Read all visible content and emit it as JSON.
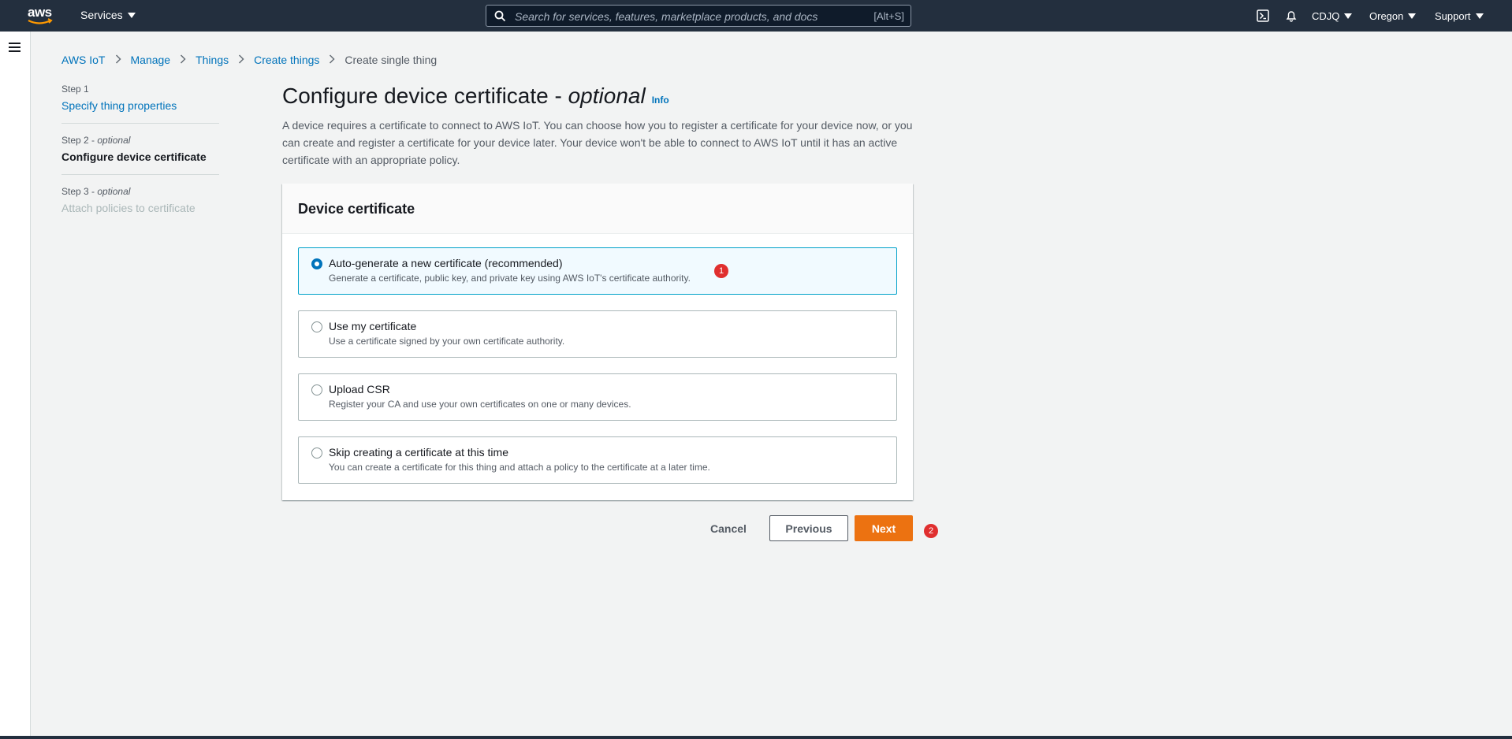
{
  "topnav": {
    "logo_text": "aws",
    "services_label": "Services",
    "search_placeholder": "Search for services, features, marketplace products, and docs",
    "search_shortcut": "[Alt+S]",
    "account_label": "CDJQ",
    "region_label": "Oregon",
    "support_label": "Support",
    "icons": [
      "cloudshell-icon",
      "bell-icon",
      "search-icon"
    ]
  },
  "breadcrumb": {
    "items": [
      "AWS IoT",
      "Manage",
      "Things",
      "Create things"
    ],
    "current": "Create single thing"
  },
  "steps": [
    {
      "label": "Step 1",
      "optional": "",
      "title": "Specify thing properties",
      "state": "link"
    },
    {
      "label": "Step 2",
      "optional": "optional",
      "title": "Configure device certificate",
      "state": "active"
    },
    {
      "label": "Step 3",
      "optional": "optional",
      "title": "Attach policies to certificate",
      "state": "disabled"
    }
  ],
  "main": {
    "title": "Configure device certificate - ",
    "title_optional": "optional",
    "info_label": "Info",
    "description": "A device requires a certificate to connect to AWS IoT. You can choose how you to register a certificate for your device now, or you can create and register a certificate for your device later. Your device won't be able to connect to AWS IoT until it has an active certificate with an appropriate policy."
  },
  "panel": {
    "header": "Device certificate",
    "options": [
      {
        "title": "Auto-generate a new certificate (recommended)",
        "desc": "Generate a certificate, public key, and private key using AWS IoT's certificate authority.",
        "selected": true
      },
      {
        "title": "Use my certificate",
        "desc": "Use a certificate signed by your own certificate authority.",
        "selected": false
      },
      {
        "title": "Upload CSR",
        "desc": "Register your CA and use your own certificates on one or many devices.",
        "selected": false
      },
      {
        "title": "Skip creating a certificate at this time",
        "desc": "You can create a certificate for this thing and attach a policy to the certificate at a later time.",
        "selected": false
      }
    ]
  },
  "actions": {
    "cancel": "Cancel",
    "previous": "Previous",
    "next": "Next"
  },
  "markers": [
    "1",
    "2"
  ],
  "colors": {
    "nav_bg": "#232f3e",
    "link": "#0073bb",
    "primary_button": "#ec7211",
    "selected_border": "#00a1c9",
    "marker": "#e02f2f"
  }
}
